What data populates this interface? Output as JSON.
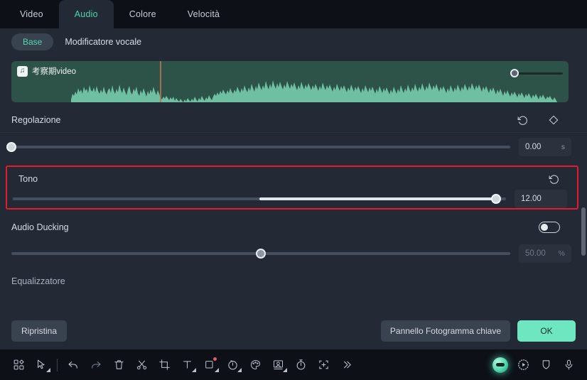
{
  "tabs": [
    {
      "label": "Video",
      "active": false
    },
    {
      "label": "Audio",
      "active": true
    },
    {
      "label": "Colore",
      "active": false
    },
    {
      "label": "Velocità",
      "active": false
    }
  ],
  "subtabs": {
    "base_label": "Base",
    "voice_modifier_label": "Modificatore vocale"
  },
  "clip": {
    "title": "考察期video",
    "icon": "music-note-icon",
    "volume_percent": 4
  },
  "sections": {
    "regolazione": {
      "title": "Regolazione",
      "reset_icon": "reset-icon",
      "keyframe_icon": "diamond-keyframe-icon",
      "value": "0.00",
      "unit": "s",
      "slider_percent": 0
    },
    "tono": {
      "title": "Tono",
      "reset_icon": "reset-icon",
      "value": "12.00",
      "unit": "",
      "slider_percent": 98,
      "fill_from_percent": 50,
      "highlight_color": "#e8192c"
    },
    "audio_ducking": {
      "title": "Audio Ducking",
      "toggle_on": false,
      "value": "50.00",
      "unit": "%",
      "slider_percent": 50
    },
    "equalizzatore": {
      "title": "Equalizzatore"
    }
  },
  "footer": {
    "reset_label": "Ripristina",
    "keyframe_panel_label": "Pannello Fotogramma chiave",
    "ok_label": "OK",
    "ok_color": "#6ee7c0"
  },
  "toolbar": {
    "left_icons": [
      "grid-shapes-icon",
      "cursor-select-icon",
      "undo-icon",
      "redo-icon",
      "trash-icon",
      "scissors-icon",
      "crop-icon",
      "text-icon",
      "shape-square-icon",
      "speed-clock-icon",
      "color-palette-icon",
      "image-mask-icon",
      "stopwatch-icon",
      "add-frame-icon",
      "chevron-double-right-icon"
    ],
    "right_icons": [
      "ai-assistant-icon",
      "dotted-play-icon",
      "shield-icon",
      "microphone-icon"
    ]
  },
  "colors": {
    "panel_bg": "#232a36",
    "window_bg": "#0b0e14",
    "accent": "#4fd6ad",
    "clip_bg": "#2d5349",
    "wave": "#6fbfa3",
    "playhead": "#b8744f"
  }
}
